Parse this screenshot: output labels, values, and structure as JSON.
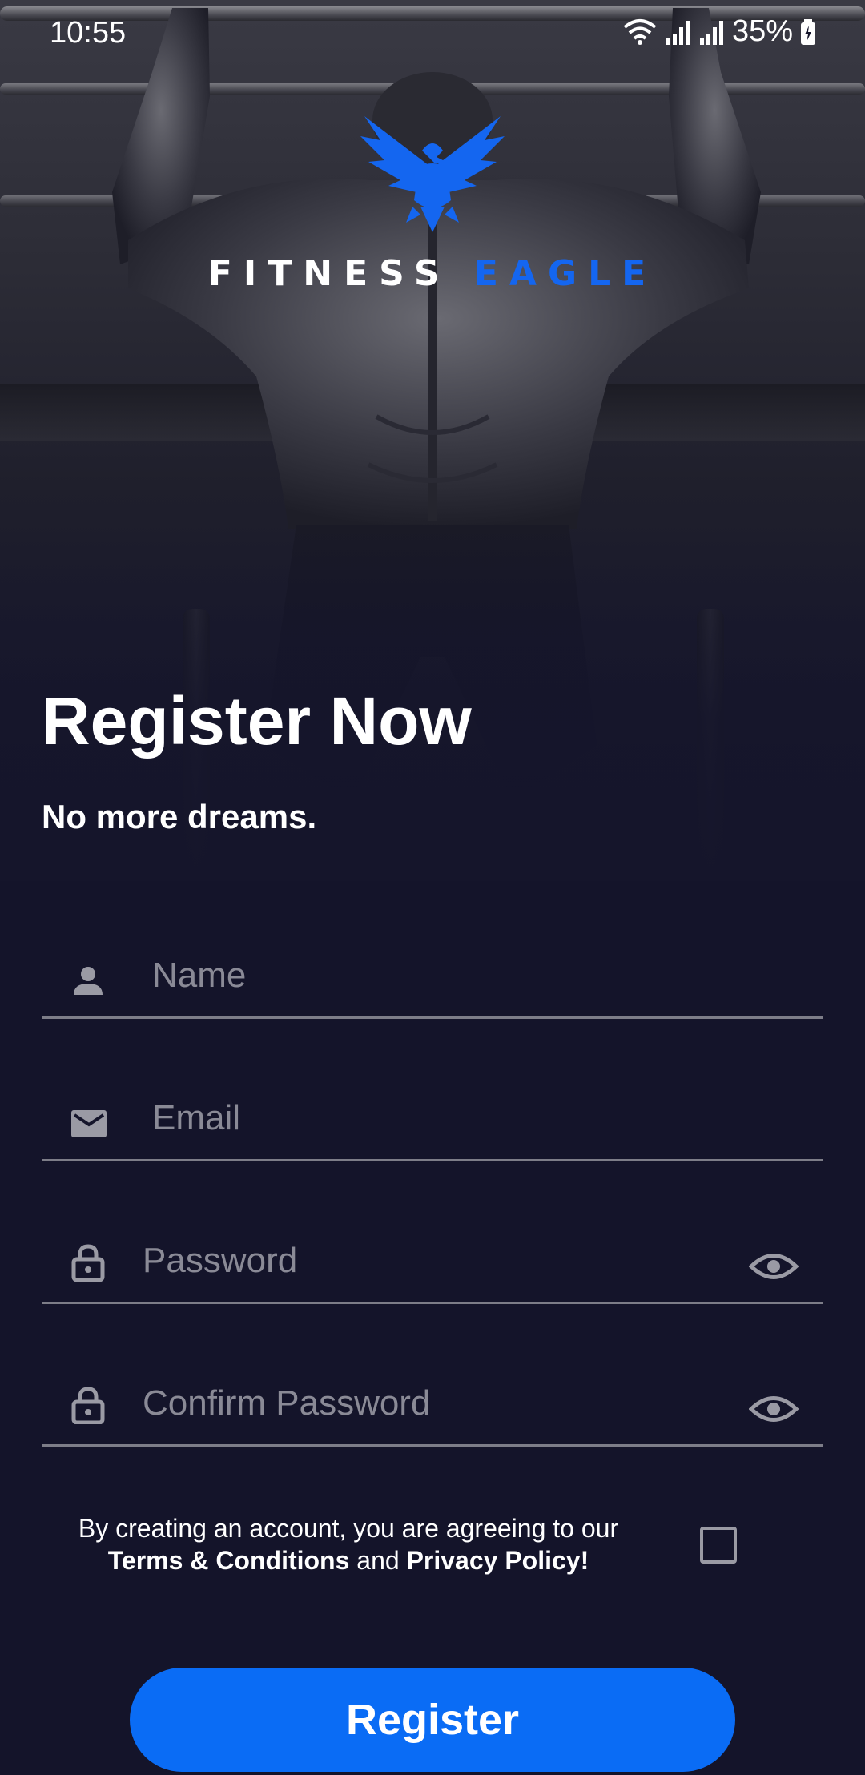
{
  "status_bar": {
    "time": "10:55",
    "battery": "35%"
  },
  "brand": {
    "part1": "FITNESS",
    "part2": "EAGLE",
    "primary_color": "#ffffff",
    "accent_color": "#1466f0",
    "logo_icon": "eagle-icon"
  },
  "header": {
    "title": "Register Now",
    "subtitle": "No more dreams."
  },
  "form": {
    "name": {
      "placeholder": "Name",
      "value": "",
      "icon": "person-icon"
    },
    "email": {
      "placeholder": "Email",
      "value": "",
      "icon": "mail-icon"
    },
    "password": {
      "placeholder": "Password",
      "value": "",
      "icon": "lock-icon",
      "toggle_icon": "eye-icon"
    },
    "confirm_password": {
      "placeholder": "Confirm Password",
      "value": "",
      "icon": "lock-icon",
      "toggle_icon": "eye-icon"
    }
  },
  "terms": {
    "line1": "By creating an account, you are agreeing to our",
    "terms_link": "Terms & Conditions",
    "connector": "and",
    "privacy_link": "Privacy Policy!",
    "checked": false
  },
  "register_button": {
    "label": "Register",
    "color": "#0a6cf5"
  }
}
